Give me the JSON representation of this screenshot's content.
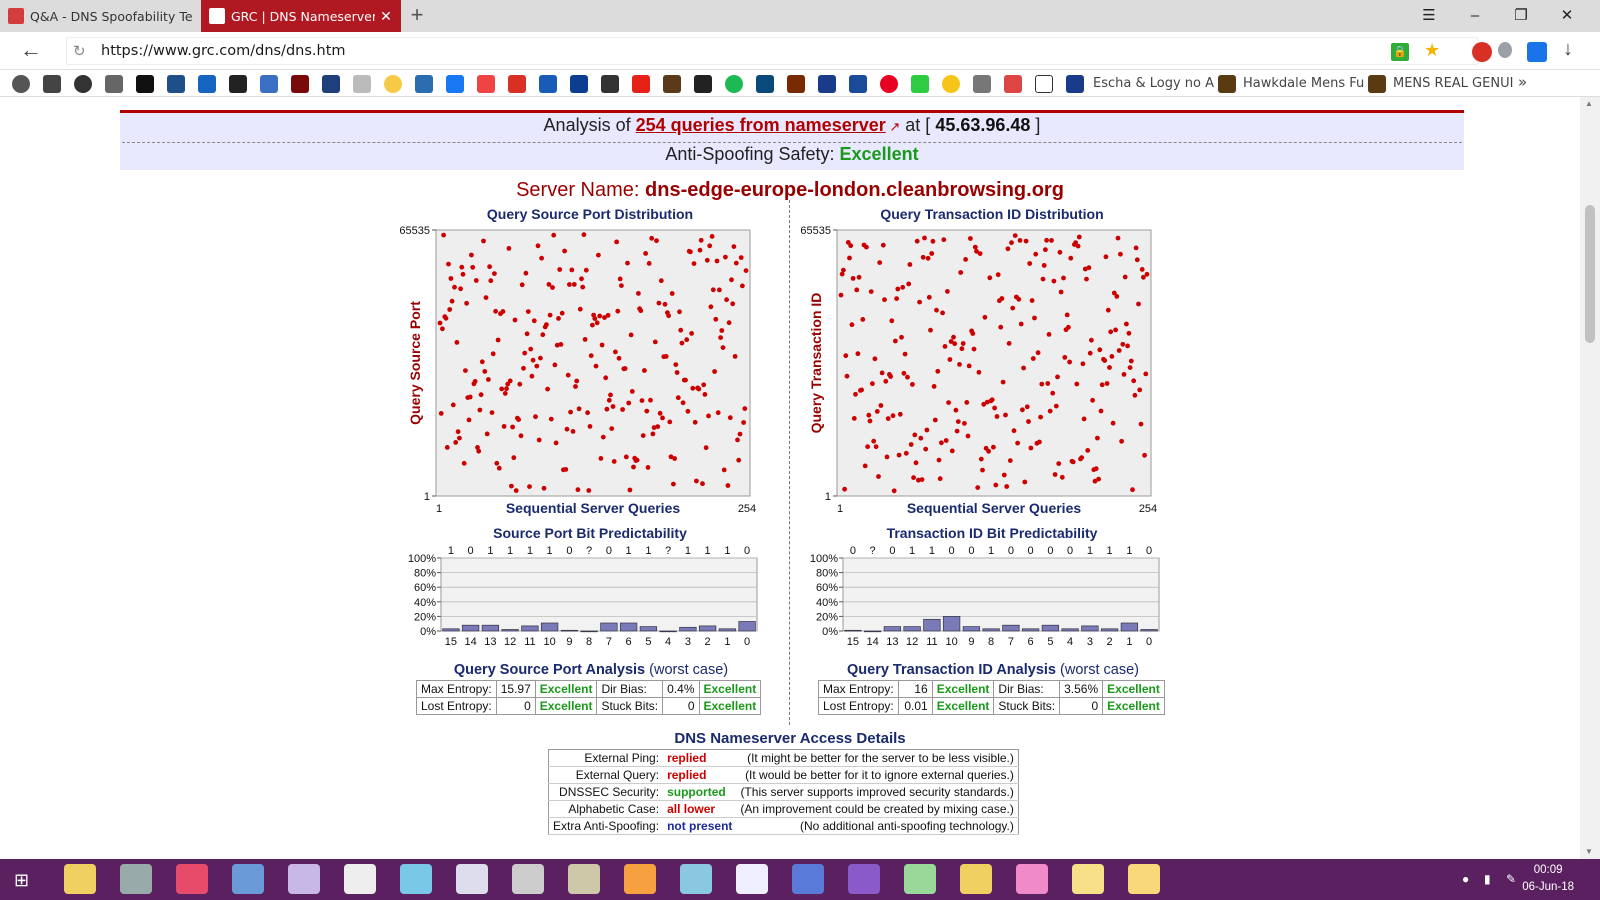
{
  "browser": {
    "tabs": [
      {
        "title": "Q&A - DNS Spoofability Test",
        "active": false
      },
      {
        "title": "GRC | DNS Nameserver Spoofability Test",
        "active": true
      }
    ],
    "new_tab": "+",
    "window_controls": {
      "menu": "☰",
      "minimize": "–",
      "restore": "❐",
      "close": "✕"
    },
    "back_icon": "←",
    "reload_icon": "↻",
    "url": "https://www.grc.com/dns/dns.htm",
    "download_icon": "↓",
    "bookmarks": [
      "Escha & Logy no A",
      "Hawkdale Mens Fu",
      "MENS REAL GENUI"
    ],
    "bookmarks_overflow": "»"
  },
  "page": {
    "analysis_prefix": "Analysis of",
    "analysis_link": "254 queries from nameserver",
    "analysis_at": "at [",
    "ip": "45.63.96.48",
    "analysis_close": "]",
    "safety_label": "Anti-Spoofing Safety:",
    "safety_value": "Excellent",
    "server_label": "Server Name:",
    "server_name": "dns-edge-europe-london.cleanbrowsing.org"
  },
  "chart_data": [
    {
      "type": "scatter",
      "title": "Query Source Port Distribution",
      "xlabel": "Sequential Server Queries",
      "ylabel": "Query Source Port",
      "xlim": [
        1,
        254
      ],
      "ylim": [
        1,
        65535
      ],
      "x_ticks": [
        "1",
        "254"
      ],
      "y_ticks": [
        "1",
        "65535"
      ],
      "points": "254 pseudo-random points uniformly spread across the full range",
      "color": "#cc0000"
    },
    {
      "type": "scatter",
      "title": "Query Transaction ID Distribution",
      "xlabel": "Sequential Server Queries",
      "ylabel": "Query Transaction ID",
      "xlim": [
        1,
        254
      ],
      "ylim": [
        1,
        65535
      ],
      "x_ticks": [
        "1",
        "254"
      ],
      "y_ticks": [
        "1",
        "65535"
      ],
      "points": "254 pseudo-random points uniformly spread across the full range",
      "color": "#cc0000"
    },
    {
      "type": "bar",
      "title": "Source Port Bit Predictability",
      "categories": [
        "15",
        "14",
        "13",
        "12",
        "11",
        "10",
        "9",
        "8",
        "7",
        "6",
        "5",
        "4",
        "3",
        "2",
        "1",
        "0"
      ],
      "top_labels": [
        "1",
        "0",
        "1",
        "1",
        "1",
        "1",
        "0",
        "?",
        "0",
        "1",
        "1",
        "?",
        "1",
        "1",
        "1",
        "0"
      ],
      "values": [
        3,
        8,
        8,
        2,
        7,
        11,
        1,
        0,
        11,
        11,
        6,
        0,
        5,
        7,
        3,
        13
      ],
      "y_ticks": [
        "0%",
        "20%",
        "40%",
        "60%",
        "80%",
        "100%"
      ],
      "ylim": [
        0,
        100
      ],
      "color": "#7a7ab8"
    },
    {
      "type": "bar",
      "title": "Transaction ID Bit Predictability",
      "categories": [
        "15",
        "14",
        "13",
        "12",
        "11",
        "10",
        "9",
        "8",
        "7",
        "6",
        "5",
        "4",
        "3",
        "2",
        "1",
        "0"
      ],
      "top_labels": [
        "0",
        "?",
        "0",
        "1",
        "1",
        "0",
        "0",
        "1",
        "0",
        "0",
        "0",
        "0",
        "1",
        "1",
        "1",
        "0"
      ],
      "values": [
        1,
        0,
        6,
        6,
        16,
        20,
        6,
        3,
        8,
        3,
        8,
        3,
        7,
        3,
        11,
        2
      ],
      "y_ticks": [
        "0%",
        "20%",
        "40%",
        "60%",
        "80%",
        "100%"
      ],
      "ylim": [
        0,
        100
      ],
      "color": "#7a7ab8"
    }
  ],
  "source_port_analysis": {
    "title": "Query Source Port Analysis",
    "suffix": "(worst case)",
    "rows": [
      [
        "Max Entropy:",
        "15.97",
        "Excellent",
        "Dir Bias:",
        "0.4%",
        "Excellent"
      ],
      [
        "Lost Entropy:",
        "0",
        "Excellent",
        "Stuck Bits:",
        "0",
        "Excellent"
      ]
    ]
  },
  "txid_analysis": {
    "title": "Query Transaction ID Analysis",
    "suffix": "(worst case)",
    "rows": [
      [
        "Max Entropy:",
        "16",
        "Excellent",
        "Dir Bias:",
        "3.56%",
        "Excellent"
      ],
      [
        "Lost Entropy:",
        "0.01",
        "Excellent",
        "Stuck Bits:",
        "0",
        "Excellent"
      ]
    ]
  },
  "access": {
    "title": "DNS Nameserver Access Details",
    "rows": [
      {
        "key": "External Ping:",
        "value": "replied",
        "color": "#cc0000",
        "note": "(It might be better for the server to be less visible.)"
      },
      {
        "key": "External Query:",
        "value": "replied",
        "color": "#cc0000",
        "note": "(It would be better for it to ignore external queries.)"
      },
      {
        "key": "DNSSEC Security:",
        "value": "supported",
        "color": "#1a9a1a",
        "note": "(This server supports improved security standards.)"
      },
      {
        "key": "Alphabetic Case:",
        "value": "all lower",
        "color": "#cc0000",
        "note": "(An improvement could be created by mixing case.)"
      },
      {
        "key": "Extra Anti-Spoofing:",
        "value": "not present",
        "color": "#1a2a9e",
        "note": "(No additional anti-spoofing technology.)"
      }
    ]
  },
  "taskbar": {
    "start_icon": "⊞",
    "time": "00:09",
    "date": "06-Jun-18"
  }
}
